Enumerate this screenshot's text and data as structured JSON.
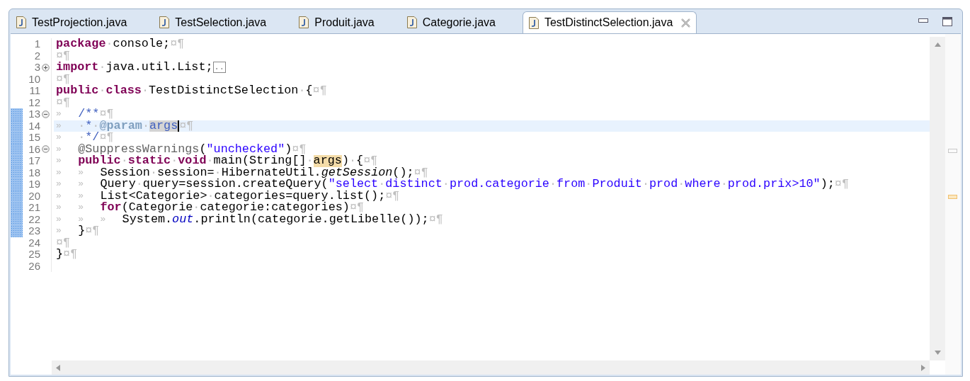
{
  "tabs": [
    {
      "label": "TestProjection.java",
      "selected": false
    },
    {
      "label": "TestSelection.java",
      "selected": false
    },
    {
      "label": "Produit.java",
      "selected": false
    },
    {
      "label": "Categorie.java",
      "selected": false
    },
    {
      "label": "TestDistinctSelection.java",
      "selected": true
    }
  ],
  "lines": [
    {
      "number": "1",
      "changed": false,
      "current": false,
      "tokens": [
        {
          "kind": "keyword",
          "text": "package"
        },
        {
          "kind": "space",
          "text": "·"
        },
        {
          "kind": "plain",
          "text": "console;"
        },
        {
          "kind": "eol",
          "text": "¤¶"
        }
      ]
    },
    {
      "number": "2",
      "changed": false,
      "current": false,
      "tokens": [
        {
          "kind": "eol",
          "text": "¤¶"
        }
      ]
    },
    {
      "number": "3",
      "collapsed": true,
      "changed": false,
      "current": false,
      "tokens": [
        {
          "kind": "keyword",
          "text": "import"
        },
        {
          "kind": "space",
          "text": "·"
        },
        {
          "kind": "plain",
          "text": "java.util.List;"
        },
        {
          "kind": "folded",
          "text": ".."
        }
      ]
    },
    {
      "number": "10",
      "changed": false,
      "current": false,
      "tokens": [
        {
          "kind": "eol",
          "text": "¤¶"
        }
      ]
    },
    {
      "number": "11",
      "changed": false,
      "current": false,
      "tokens": [
        {
          "kind": "keyword",
          "text": "public"
        },
        {
          "kind": "space",
          "text": "·"
        },
        {
          "kind": "keyword",
          "text": "class"
        },
        {
          "kind": "space",
          "text": "·"
        },
        {
          "kind": "plain",
          "text": "TestDistinctSelection"
        },
        {
          "kind": "space",
          "text": "·"
        },
        {
          "kind": "plain",
          "text": "{"
        },
        {
          "kind": "eol",
          "text": "¤¶"
        }
      ]
    },
    {
      "number": "12",
      "changed": false,
      "current": false,
      "tokens": [
        {
          "kind": "eol",
          "text": "¤¶"
        }
      ]
    },
    {
      "number": "13",
      "collapsed": false,
      "changed": true,
      "current": false,
      "tokens": [
        {
          "kind": "tab",
          "text": "»"
        },
        {
          "kind": "doc",
          "text": "/**"
        },
        {
          "kind": "eol",
          "text": "¤¶"
        }
      ]
    },
    {
      "number": "14",
      "changed": true,
      "current": true,
      "tokens": [
        {
          "kind": "tab",
          "text": "»"
        },
        {
          "kind": "space",
          "text": "·"
        },
        {
          "kind": "doc",
          "text": "*"
        },
        {
          "kind": "space",
          "text": "·"
        },
        {
          "kind": "doctag",
          "text": "@param"
        },
        {
          "kind": "space",
          "text": "·"
        },
        {
          "kind": "selection",
          "text": "args"
        },
        {
          "kind": "eol",
          "text": "¤¶"
        }
      ]
    },
    {
      "number": "15",
      "changed": true,
      "current": false,
      "tokens": [
        {
          "kind": "tab",
          "text": "»"
        },
        {
          "kind": "space",
          "text": "·"
        },
        {
          "kind": "doc",
          "text": "*/"
        },
        {
          "kind": "eol",
          "text": "¤¶"
        }
      ]
    },
    {
      "number": "16",
      "collapsed": false,
      "changed": true,
      "current": false,
      "tokens": [
        {
          "kind": "tab",
          "text": "»"
        },
        {
          "kind": "annotation",
          "text": "@SuppressWarnings"
        },
        {
          "kind": "plain",
          "text": "("
        },
        {
          "kind": "string",
          "text": "\"unchecked\""
        },
        {
          "kind": "plain",
          "text": ")"
        },
        {
          "kind": "eol",
          "text": "¤¶"
        }
      ]
    },
    {
      "number": "17",
      "changed": true,
      "current": false,
      "tokens": [
        {
          "kind": "tab",
          "text": "»"
        },
        {
          "kind": "keyword",
          "text": "public"
        },
        {
          "kind": "space",
          "text": "·"
        },
        {
          "kind": "keyword",
          "text": "static"
        },
        {
          "kind": "space",
          "text": "·"
        },
        {
          "kind": "keyword",
          "text": "void"
        },
        {
          "kind": "space",
          "text": "·"
        },
        {
          "kind": "plain",
          "text": "main(String[]"
        },
        {
          "kind": "space",
          "text": "·"
        },
        {
          "kind": "occurrence",
          "text": "args"
        },
        {
          "kind": "plain",
          "text": ")"
        },
        {
          "kind": "space",
          "text": "·"
        },
        {
          "kind": "plain",
          "text": "{"
        },
        {
          "kind": "eol",
          "text": "¤¶"
        }
      ]
    },
    {
      "number": "18",
      "changed": true,
      "current": false,
      "tokens": [
        {
          "kind": "tab",
          "text": "»"
        },
        {
          "kind": "tab",
          "text": "»"
        },
        {
          "kind": "plain",
          "text": "Session"
        },
        {
          "kind": "space",
          "text": "·"
        },
        {
          "kind": "plain",
          "text": "session="
        },
        {
          "kind": "space",
          "text": "·"
        },
        {
          "kind": "plain",
          "text": "HibernateUtil."
        },
        {
          "kind": "static-method",
          "text": "getSession"
        },
        {
          "kind": "plain",
          "text": "();"
        },
        {
          "kind": "eol",
          "text": "¤¶"
        }
      ]
    },
    {
      "number": "19",
      "changed": true,
      "current": false,
      "tokens": [
        {
          "kind": "tab",
          "text": "»"
        },
        {
          "kind": "tab",
          "text": "»"
        },
        {
          "kind": "plain",
          "text": "Query"
        },
        {
          "kind": "space",
          "text": "·"
        },
        {
          "kind": "plain",
          "text": "query=session.createQuery("
        },
        {
          "kind": "string",
          "text": "\"select"
        },
        {
          "kind": "space",
          "text": "·"
        },
        {
          "kind": "string",
          "text": "distinct"
        },
        {
          "kind": "space",
          "text": "·"
        },
        {
          "kind": "string",
          "text": "prod.categorie"
        },
        {
          "kind": "space",
          "text": "·"
        },
        {
          "kind": "string",
          "text": "from"
        },
        {
          "kind": "space",
          "text": "·"
        },
        {
          "kind": "string",
          "text": "Produit"
        },
        {
          "kind": "space",
          "text": "·"
        },
        {
          "kind": "string",
          "text": "prod"
        },
        {
          "kind": "space",
          "text": "·"
        },
        {
          "kind": "string",
          "text": "where"
        },
        {
          "kind": "space",
          "text": "·"
        },
        {
          "kind": "string",
          "text": "prod.prix>10\""
        },
        {
          "kind": "plain",
          "text": ");"
        },
        {
          "kind": "eol",
          "text": "¤¶"
        }
      ]
    },
    {
      "number": "20",
      "changed": true,
      "current": false,
      "tokens": [
        {
          "kind": "tab",
          "text": "»"
        },
        {
          "kind": "tab",
          "text": "»"
        },
        {
          "kind": "plain",
          "text": "List<Categorie>"
        },
        {
          "kind": "space",
          "text": "·"
        },
        {
          "kind": "plain",
          "text": "categories=query.list();"
        },
        {
          "kind": "eol",
          "text": "¤¶"
        }
      ]
    },
    {
      "number": "21",
      "changed": true,
      "current": false,
      "tokens": [
        {
          "kind": "tab",
          "text": "»"
        },
        {
          "kind": "tab",
          "text": "»"
        },
        {
          "kind": "keyword",
          "text": "for"
        },
        {
          "kind": "plain",
          "text": "(Categorie"
        },
        {
          "kind": "space",
          "text": "·"
        },
        {
          "kind": "plain",
          "text": "categorie:categories)"
        },
        {
          "kind": "eol",
          "text": "¤¶"
        }
      ]
    },
    {
      "number": "22",
      "changed": true,
      "current": false,
      "tokens": [
        {
          "kind": "tab",
          "text": "»"
        },
        {
          "kind": "tab",
          "text": "»"
        },
        {
          "kind": "tab",
          "text": "»"
        },
        {
          "kind": "plain",
          "text": "System."
        },
        {
          "kind": "static-field",
          "text": "out"
        },
        {
          "kind": "plain",
          "text": ".println(categorie.getLibelle());"
        },
        {
          "kind": "eol",
          "text": "¤¶"
        }
      ]
    },
    {
      "number": "23",
      "changed": true,
      "current": false,
      "tokens": [
        {
          "kind": "tab",
          "text": "»"
        },
        {
          "kind": "plain",
          "text": "}"
        },
        {
          "kind": "eol",
          "text": "¤¶"
        }
      ]
    },
    {
      "number": "24",
      "changed": false,
      "current": false,
      "tokens": [
        {
          "kind": "eol",
          "text": "¤¶"
        }
      ]
    },
    {
      "number": "25",
      "changed": false,
      "current": false,
      "tokens": [
        {
          "kind": "plain",
          "text": "}"
        },
        {
          "kind": "eol",
          "text": "¤¶"
        }
      ]
    },
    {
      "number": "26",
      "changed": false,
      "current": false
    }
  ]
}
